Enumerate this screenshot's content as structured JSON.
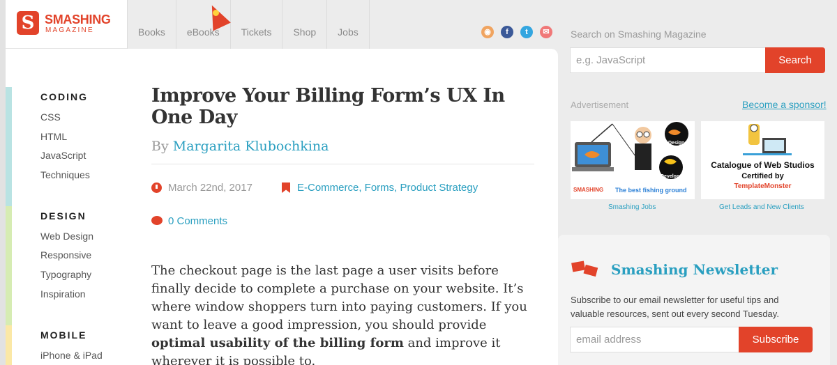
{
  "logo": {
    "letter": "S",
    "name": "SMASHING",
    "sub": "MAGAZINE"
  },
  "nav": [
    {
      "label": "Books"
    },
    {
      "label": "eBooks"
    },
    {
      "label": "Tickets"
    },
    {
      "label": "Shop"
    },
    {
      "label": "Jobs"
    }
  ],
  "social": [
    {
      "icon": "rss-icon",
      "color": "#f0a460"
    },
    {
      "icon": "facebook-icon",
      "color": "#3b5998"
    },
    {
      "icon": "twitter-icon",
      "color": "#33a6e0"
    },
    {
      "icon": "email-icon",
      "color": "#f07878"
    }
  ],
  "sidebar": {
    "sections": [
      {
        "heading": "CODING",
        "color": "#b9e3e3",
        "items": [
          "CSS",
          "HTML",
          "JavaScript",
          "Techniques"
        ]
      },
      {
        "heading": "DESIGN",
        "color": "#d6ecb3",
        "items": [
          "Web Design",
          "Responsive",
          "Typography",
          "Inspiration"
        ]
      },
      {
        "heading": "MOBILE",
        "color": "#fbe8a6",
        "items": [
          "iPhone & iPad"
        ]
      }
    ]
  },
  "article": {
    "title": "Improve Your Billing Form’s UX In One Day",
    "by": "By",
    "author": "Margarita Klubochkina",
    "date": "March 22nd, 2017",
    "categories": "E-Commerce, Forms, Product Strategy",
    "comments": "0 Comments",
    "intro_1": "The checkout page is the last page a user visits before finally decide to complete a purchase on your website. It’s where window shoppers turn into paying customers. If you want to leave a good impression, you should provide ",
    "intro_bold": "optimal usability of the billing form",
    "intro_2": " and improve it wherever it is possible to."
  },
  "search": {
    "label": "Search on Smashing Magazine",
    "placeholder": "e.g. JavaScript",
    "button": "Search"
  },
  "ads": {
    "label": "Advertisement",
    "sponsor_link": "Become a sponsor!",
    "ad1": {
      "designer": "Designer",
      "developer": "Developer",
      "brand": "SMASHING",
      "tagline": "The best fishing ground",
      "caption": "Smashing Jobs"
    },
    "ad2": {
      "line1": "Catalogue of Web Studios",
      "line2": "Certified by",
      "brand": "TemplateMonster",
      "caption": "Get Leads and New Clients"
    }
  },
  "newsletter": {
    "title": "Smashing Newsletter",
    "description": "Subscribe to our email newsletter for useful tips and valuable resources, sent out every second Tuesday.",
    "placeholder": "email address",
    "button": "Subscribe"
  }
}
